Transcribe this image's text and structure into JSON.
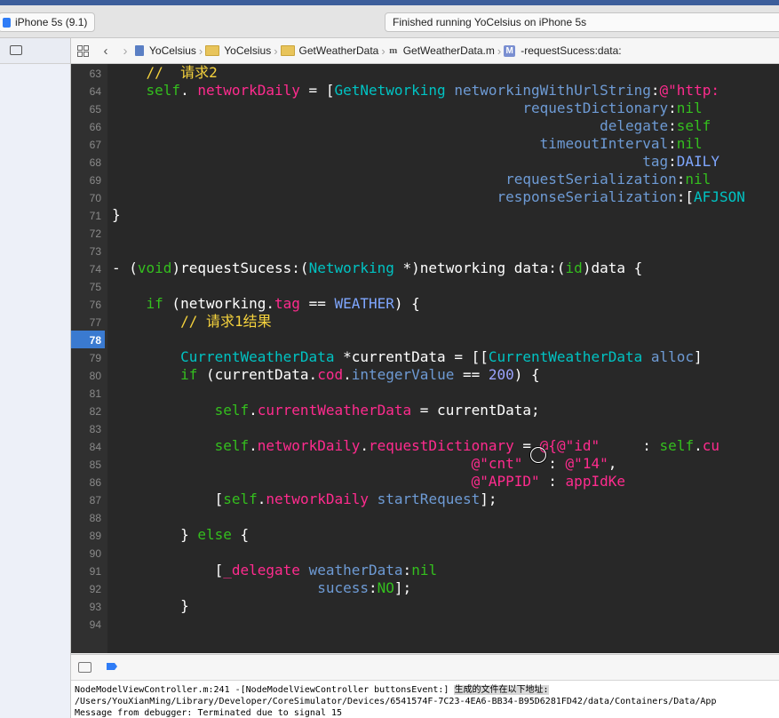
{
  "toolbar": {
    "scheme_device": "iPhone 5s (9.1)",
    "status": "Finished running YoCelsius on iPhone 5s"
  },
  "jumpbar": {
    "crumbs": [
      "YoCelsius",
      "YoCelsius",
      "GetWeatherData",
      "GetWeatherData.m",
      "-requestSucess:data:"
    ]
  },
  "editor": {
    "breakpoint_line": "78",
    "lines": [
      {
        "n": "63",
        "t": [
          [
            "c-com",
            "    //  请求2"
          ]
        ]
      },
      {
        "n": "64",
        "t": [
          [
            "",
            "    "
          ],
          [
            "c-key",
            "self"
          ],
          [
            "",
            ". "
          ],
          [
            "c-prop",
            "networkDaily"
          ],
          [
            "",
            " = ["
          ],
          [
            "c-cls",
            "GetNetworking"
          ],
          [
            "",
            " "
          ],
          [
            "c-sel",
            "networkingWithUrlString"
          ],
          [
            "",
            ":"
          ],
          [
            "c-str",
            "@\"http:"
          ]
        ]
      },
      {
        "n": "65",
        "t": [
          [
            "",
            "                                                "
          ],
          [
            "c-sel",
            "requestDictionary"
          ],
          [
            "",
            ":"
          ],
          [
            "c-key",
            "nil"
          ]
        ]
      },
      {
        "n": "66",
        "t": [
          [
            "",
            "                                                         "
          ],
          [
            "c-sel",
            "delegate"
          ],
          [
            "",
            ":"
          ],
          [
            "c-key",
            "self"
          ]
        ]
      },
      {
        "n": "67",
        "t": [
          [
            "",
            "                                                  "
          ],
          [
            "c-sel",
            "timeoutInterval"
          ],
          [
            "",
            ":"
          ],
          [
            "c-key",
            "nil"
          ]
        ]
      },
      {
        "n": "68",
        "t": [
          [
            "",
            "                                                              "
          ],
          [
            "c-sel",
            "tag"
          ],
          [
            "",
            ":"
          ],
          [
            "c-mac",
            "DAILY"
          ]
        ]
      },
      {
        "n": "69",
        "t": [
          [
            "",
            "                                              "
          ],
          [
            "c-sel",
            "requestSerialization"
          ],
          [
            "",
            ":"
          ],
          [
            "c-key",
            "nil"
          ]
        ]
      },
      {
        "n": "70",
        "t": [
          [
            "",
            "                                             "
          ],
          [
            "c-sel",
            "responseSerialization"
          ],
          [
            "",
            ":["
          ],
          [
            "c-cls",
            "AFJSON"
          ]
        ]
      },
      {
        "n": "71",
        "t": [
          [
            "",
            "}"
          ]
        ]
      },
      {
        "n": "72",
        "t": []
      },
      {
        "n": "73",
        "t": []
      },
      {
        "n": "74",
        "t": [
          [
            "",
            "- ("
          ],
          [
            "c-key",
            "void"
          ],
          [
            "",
            ")requestSucess:("
          ],
          [
            "c-cls",
            "Networking"
          ],
          [
            "",
            " *)networking data:("
          ],
          [
            "c-key",
            "id"
          ],
          [
            "",
            ")data {"
          ]
        ]
      },
      {
        "n": "75",
        "t": []
      },
      {
        "n": "76",
        "t": [
          [
            "",
            "    "
          ],
          [
            "c-key",
            "if"
          ],
          [
            "",
            " (networking."
          ],
          [
            "c-prop",
            "tag"
          ],
          [
            "",
            " == "
          ],
          [
            "c-mac",
            "WEATHER"
          ],
          [
            "",
            ") {"
          ]
        ]
      },
      {
        "n": "77",
        "t": [
          [
            "c-com",
            "        // 请求1结果"
          ]
        ]
      },
      {
        "n": "78",
        "t": []
      },
      {
        "n": "79",
        "t": [
          [
            "",
            "        "
          ],
          [
            "c-cls",
            "CurrentWeatherData"
          ],
          [
            "",
            " *currentData = [["
          ],
          [
            "c-cls",
            "CurrentWeatherData"
          ],
          [
            "",
            " "
          ],
          [
            "c-sel",
            "alloc"
          ],
          [
            "",
            "]"
          ]
        ]
      },
      {
        "n": "80",
        "t": [
          [
            "",
            "        "
          ],
          [
            "c-key",
            "if"
          ],
          [
            "",
            " (currentData."
          ],
          [
            "c-prop",
            "cod"
          ],
          [
            "",
            "."
          ],
          [
            "c-sel",
            "integerValue"
          ],
          [
            "",
            " == "
          ],
          [
            "c-num",
            "200"
          ],
          [
            "",
            ") {"
          ]
        ]
      },
      {
        "n": "81",
        "t": []
      },
      {
        "n": "82",
        "t": [
          [
            "",
            "            "
          ],
          [
            "c-key",
            "self"
          ],
          [
            "",
            "."
          ],
          [
            "c-prop",
            "currentWeatherData"
          ],
          [
            "",
            " = currentData;"
          ]
        ]
      },
      {
        "n": "83",
        "t": []
      },
      {
        "n": "84",
        "t": [
          [
            "",
            "            "
          ],
          [
            "c-key",
            "self"
          ],
          [
            "",
            "."
          ],
          [
            "c-prop",
            "networkDaily"
          ],
          [
            "",
            "."
          ],
          [
            "c-prop",
            "requestDictionary"
          ],
          [
            "",
            " = "
          ],
          [
            "c-str",
            "@{"
          ],
          [
            "c-str",
            "@\"id\""
          ],
          [
            "",
            "     : "
          ],
          [
            "c-key",
            "self"
          ],
          [
            "",
            "."
          ],
          [
            "c-prop",
            "cu"
          ]
        ]
      },
      {
        "n": "85",
        "t": [
          [
            "",
            "                                          "
          ],
          [
            "c-str",
            "@\"cnt\""
          ],
          [
            "",
            "   : "
          ],
          [
            "c-str",
            "@\"14\""
          ],
          [
            "",
            ","
          ]
        ]
      },
      {
        "n": "86",
        "t": [
          [
            "",
            "                                          "
          ],
          [
            "c-str",
            "@\"APPID\""
          ],
          [
            "",
            " : "
          ],
          [
            "c-prop",
            "appIdKe"
          ]
        ]
      },
      {
        "n": "87",
        "t": [
          [
            "",
            "            ["
          ],
          [
            "c-key",
            "self"
          ],
          [
            "",
            "."
          ],
          [
            "c-prop",
            "networkDaily"
          ],
          [
            "",
            " "
          ],
          [
            "c-sel",
            "startRequest"
          ],
          [
            "",
            "];"
          ]
        ]
      },
      {
        "n": "88",
        "t": []
      },
      {
        "n": "89",
        "t": [
          [
            "",
            "        } "
          ],
          [
            "c-key",
            "else"
          ],
          [
            "",
            " {"
          ]
        ]
      },
      {
        "n": "90",
        "t": []
      },
      {
        "n": "91",
        "t": [
          [
            "",
            "            ["
          ],
          [
            "c-prop",
            "_delegate"
          ],
          [
            "",
            " "
          ],
          [
            "c-sel",
            "weatherData"
          ],
          [
            "",
            ":"
          ],
          [
            "c-key",
            "nil"
          ]
        ]
      },
      {
        "n": "92",
        "t": [
          [
            "",
            "                        "
          ],
          [
            "c-sel",
            "sucess"
          ],
          [
            "",
            ":"
          ],
          [
            "c-key",
            "NO"
          ],
          [
            "",
            "];"
          ]
        ]
      },
      {
        "n": "93",
        "t": [
          [
            "",
            "        }"
          ]
        ]
      },
      {
        "n": "94",
        "t": []
      }
    ]
  },
  "console": {
    "line1_prefix": "NodeModelViewController.m:241 -[NodeModelViewController buttonsEvent:] ",
    "line1_highlight": "生成的文件在以下地址:",
    "line2": "/Users/YouXianMing/Library/Developer/CoreSimulator/Devices/6541574F-7C23-4EA6-BB34-B95D6281FD42/data/Containers/Data/App",
    "line3": "Message from debugger: Terminated due to signal 15"
  },
  "icons": {
    "scheme": "iphone-device-icon",
    "navigator": "message-icon",
    "grid": "related-items-icon",
    "back": "chevron-left-icon",
    "forward": "chevron-right-icon",
    "project": "project-file-icon",
    "folder": "folder-icon",
    "source": "m-file-icon",
    "method": "method-icon",
    "hide_debug": "hide-debug-area-icon",
    "breakpoints": "breakpoint-toggle-icon"
  },
  "colors": {
    "editor_bg": "#282828",
    "breakpoint": "#3a7ad0",
    "comment": "#f6d33d",
    "keyword": "#34bf1e",
    "class": "#00c3c3",
    "property": "#ff2b8e"
  }
}
